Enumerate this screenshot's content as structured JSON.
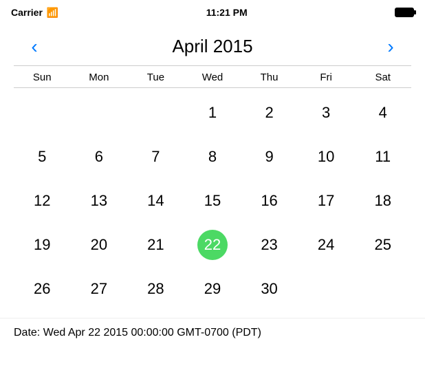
{
  "statusBar": {
    "carrier": "Carrier",
    "time": "11:21 PM"
  },
  "calendar": {
    "title": "April 2015",
    "prevArrow": "‹",
    "nextArrow": "›",
    "dayHeaders": [
      "Sun",
      "Mon",
      "Tue",
      "Wed",
      "Thu",
      "Fri",
      "Sat"
    ],
    "selectedDay": 22,
    "selectedColor": "#4CD964",
    "weeks": [
      [
        null,
        null,
        null,
        1,
        2,
        3,
        4
      ],
      [
        5,
        6,
        7,
        8,
        9,
        10,
        11
      ],
      [
        12,
        13,
        14,
        15,
        16,
        17,
        18
      ],
      [
        19,
        20,
        21,
        22,
        23,
        24,
        25
      ],
      [
        26,
        27,
        28,
        29,
        30,
        null,
        null
      ]
    ]
  },
  "footer": {
    "label": "Date:  Wed Apr 22 2015 00:00:00 GMT-0700 (PDT)"
  }
}
